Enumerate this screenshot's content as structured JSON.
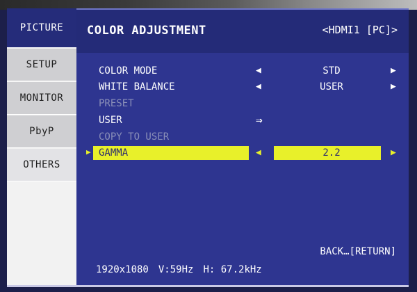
{
  "sidebar": {
    "tabs": [
      {
        "label": "PICTURE"
      },
      {
        "label": "SETUP"
      },
      {
        "label": "MONITOR"
      },
      {
        "label": "PbyP"
      },
      {
        "label": "OTHERS"
      }
    ]
  },
  "header": {
    "title": "COLOR ADJUSTMENT",
    "source": "<HDMI1 [PC]>"
  },
  "menu": {
    "rows": [
      {
        "label": "COLOR MODE",
        "value": "STD",
        "enabled": true
      },
      {
        "label": "WHITE BALANCE",
        "value": "USER",
        "enabled": true
      },
      {
        "label": "PRESET",
        "value": "",
        "enabled": false
      },
      {
        "label": "USER",
        "value": "",
        "enabled": true
      },
      {
        "label": "COPY TO USER",
        "value": "",
        "enabled": false
      },
      {
        "label": "GAMMA",
        "value": "2.2",
        "enabled": true,
        "selected": true
      }
    ]
  },
  "icons": {
    "left": "◀",
    "right": "▶",
    "enter": "⇒",
    "cursor": "▶"
  },
  "footer": {
    "back": "BACK…[RETURN]",
    "resolution": "1920x1080",
    "vfreq": "V:59Hz",
    "hfreq": "H: 67.2kHz"
  },
  "colors": {
    "osd_background": "#2e3590",
    "highlight": "#e8f02a",
    "sidebar": "#f2f2f2"
  }
}
